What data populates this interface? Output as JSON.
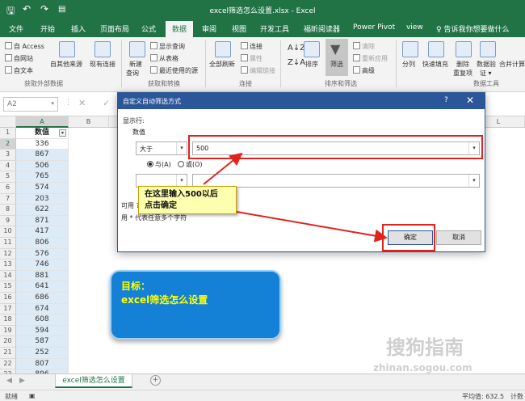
{
  "title": "excel筛选怎么设置.xlsx - Excel",
  "menu_tabs": [
    {
      "label": "文件",
      "active": false
    },
    {
      "label": "开始",
      "active": false
    },
    {
      "label": "插入",
      "active": false
    },
    {
      "label": "页面布局",
      "active": false
    },
    {
      "label": "公式",
      "active": false
    },
    {
      "label": "数据",
      "active": true
    },
    {
      "label": "审阅",
      "active": false
    },
    {
      "label": "视图",
      "active": false
    },
    {
      "label": "开发工具",
      "active": false
    },
    {
      "label": "福昕阅读器",
      "active": false
    },
    {
      "label": "Power Pivot",
      "active": false
    },
    {
      "label": "view",
      "active": false
    }
  ],
  "tell_me": "♀ 告诉我你想要做什么",
  "ribbon": {
    "access": "自 Access",
    "web": "自网站",
    "text": "自文本",
    "other_sources": "自其他来源",
    "existing": "现有连接",
    "new_query": "新建\n查询",
    "new_query_l1": "新建",
    "new_query_l2": "查询",
    "show_queries": "显示查询",
    "from_table": "从表格",
    "recent_sources": "最近使用的源",
    "refresh_all": "全部刷新",
    "connections": "连接",
    "properties": "属性",
    "edit_links": "编辑链接",
    "sort": "排序",
    "filter": "筛选",
    "clear": "清除",
    "reapply": "重新应用",
    "advanced": "高级",
    "split": "分列",
    "flash_fill": "快速填充",
    "remove_dup_l1": "删除",
    "remove_dup_l2": "重复项",
    "validation_l1": "数据验",
    "validation_l2": "证 ▾",
    "consolidate": "合并计算",
    "groups": {
      "external": "获取外部数据",
      "transform": "获取和转换",
      "connections": "连接",
      "sort_filter": "排序和筛选",
      "data_tools": "数据工具"
    }
  },
  "name_box": "A2",
  "columns": [
    "A",
    "B",
    "C",
    "D",
    "E",
    "F",
    "G",
    "H",
    "I",
    "J",
    "K",
    "L"
  ],
  "header_cell": "数值",
  "values": [
    "336",
    "867",
    "506",
    "765",
    "574",
    "203",
    "622",
    "871",
    "417",
    "806",
    "576",
    "746",
    "881",
    "641",
    "686",
    "674",
    "608",
    "594",
    "587",
    "252",
    "807",
    "896"
  ],
  "row_numbers": [
    "1",
    "2",
    "3",
    "4",
    "5",
    "6",
    "7",
    "8",
    "9",
    "10",
    "11",
    "12",
    "13",
    "14",
    "15",
    "16",
    "17",
    "18",
    "19",
    "20",
    "21",
    "22",
    "23"
  ],
  "sheet_tab": "excel筛选怎么设置",
  "status": {
    "ready": "就绪",
    "average": "平均值: 632.5",
    "count": "计数"
  },
  "dialog": {
    "title": "自定义自动筛选方式",
    "help": "?",
    "close": "✕",
    "show_rows": "显示行:",
    "field": "数值",
    "operator": "大于",
    "value": "500",
    "and": "与(A)",
    "or": "或(O)",
    "hint1": "可用 ? 代表单个字符",
    "hint2": "用 * 代表任意多个字符",
    "ok": "确定",
    "cancel": "取消"
  },
  "callout": {
    "line1": "在这里输入500以后",
    "line2": "点击确定"
  },
  "goal": {
    "line1": "目标：",
    "line2": "excel筛选怎么设置"
  },
  "watermark": {
    "main": "搜狗指南",
    "sub": "zhinan.sogou.com"
  },
  "icons": {
    "save": "save-icon",
    "undo": "undo-icon",
    "redo": "redo-icon",
    "filter": "funnel-icon"
  },
  "colors": {
    "excel_green": "#217346",
    "dialog_blue": "#2b579a",
    "highlight_red": "#e0241c",
    "callout_yellow": "#ffffb0",
    "goal_blue": "#1481d6",
    "goal_text": "#ffff00"
  }
}
